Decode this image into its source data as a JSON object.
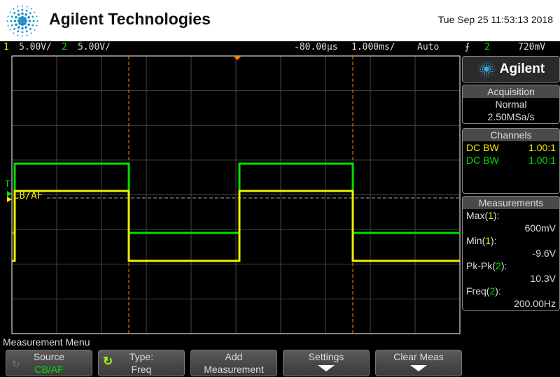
{
  "header": {
    "brand": "Agilent Technologies",
    "datetime": "Tue Sep 25 11:53:13 2018"
  },
  "status": {
    "ch1_num": "1",
    "ch1_scale": "5.00V/",
    "ch2_num": "2",
    "ch2_scale": "5.00V/",
    "time_delay": "-80.00µs",
    "time_scale": "1.000ms/",
    "trigger_mode": "Auto",
    "trigger_slope": "rising-edge-icon",
    "trigger_source": "2",
    "trigger_level": "720mV"
  },
  "plot": {
    "trigger_marker": "T",
    "label": "CB/AF",
    "colors": {
      "ch1": "#f0f000",
      "ch2": "#00e000",
      "cursor": "#ff8000"
    }
  },
  "panel": {
    "brand": "Agilent",
    "acquisition": {
      "title": "Acquisition",
      "mode": "Normal",
      "rate": "2.50MSa/s"
    },
    "channels": {
      "title": "Channels",
      "rows": [
        {
          "coupling": "DC BW",
          "probe": "1.00:1"
        },
        {
          "coupling": "DC BW",
          "probe": "1.00:1"
        }
      ]
    },
    "measurements": {
      "title": "Measurements",
      "items": [
        {
          "name": "Max",
          "src": "1",
          "value": "600mV"
        },
        {
          "name": "Min",
          "src": "1",
          "value": "-9.6V"
        },
        {
          "name": "Pk-Pk",
          "src": "2",
          "value": "10.3V"
        },
        {
          "name": "Freq",
          "src": "2",
          "value": "200.00Hz"
        }
      ]
    }
  },
  "menu": {
    "title": "Measurement Menu",
    "buttons": [
      {
        "label": "Source",
        "value": "CB/AF"
      },
      {
        "label": "Type:",
        "value": "Freq"
      },
      {
        "label": "Add",
        "value": "Measurement"
      },
      {
        "label": "Settings"
      },
      {
        "label": "Clear Meas"
      }
    ]
  }
}
